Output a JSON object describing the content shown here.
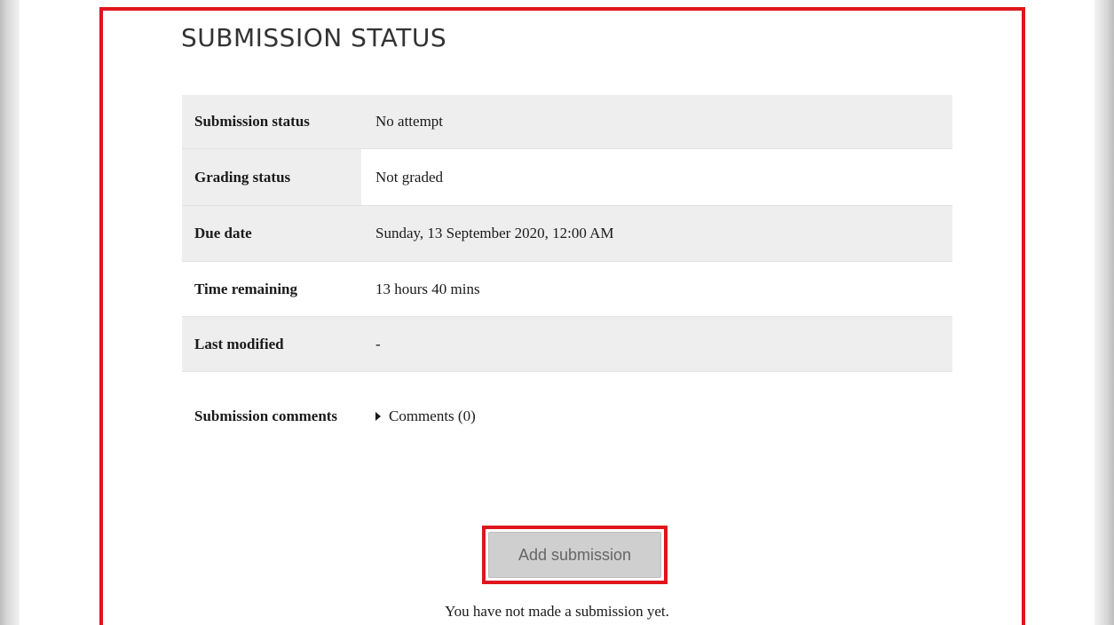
{
  "section": {
    "title": "SUBMISSION STATUS"
  },
  "rows": [
    {
      "label": "Submission status",
      "value": "No attempt"
    },
    {
      "label": "Grading status",
      "value": "Not graded"
    },
    {
      "label": "Due date",
      "value": "Sunday, 13 September 2020, 12:00 AM"
    },
    {
      "label": "Time remaining",
      "value": "13 hours 40 mins"
    },
    {
      "label": "Last modified",
      "value": "-"
    },
    {
      "label": "Submission comments",
      "value": "Comments (0)"
    }
  ],
  "actions": {
    "add_submission_label": "Add submission",
    "note": "You have not made a submission yet."
  },
  "colors": {
    "highlight": "#e0151c",
    "row_shade": "#eeeeee",
    "button_bg": "#cfcfcf"
  },
  "icons": {
    "comments_toggle": "caret-right-icon"
  }
}
